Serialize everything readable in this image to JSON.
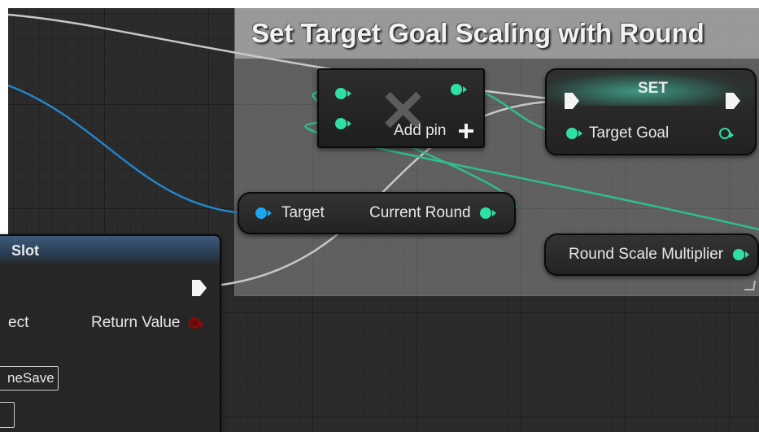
{
  "comment": {
    "title": "Set Target Goal Scaling with Round"
  },
  "add_node": {
    "add_pin_label": "Add pin"
  },
  "set_node": {
    "title": "SET",
    "pin_label": "Target Goal"
  },
  "target_node": {
    "input_label": "Target",
    "output_label": "Current Round"
  },
  "round_scale_node": {
    "label": "Round Scale Multiplier"
  },
  "slot_node": {
    "title": "Slot",
    "object_label": "ect",
    "return_label": "Return Value",
    "slot_name_value": "neSave",
    "index_value": ""
  },
  "colors": {
    "float_pin": "#2fe0a3",
    "object_pin": "#1ea5f0",
    "bool_pin": "#8a0d0d",
    "exec_pin": "#f4f4f4"
  }
}
